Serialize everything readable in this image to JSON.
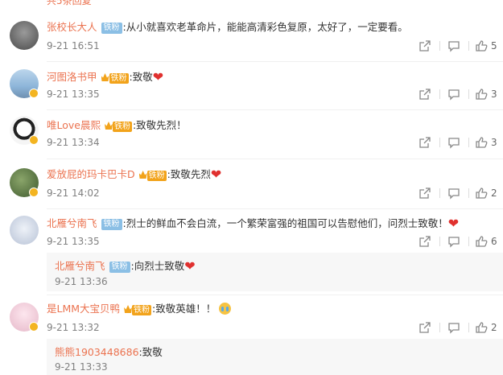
{
  "top_partial": "共5条回复",
  "badges": {
    "fan": "铁粉",
    "gold": "铁粉"
  },
  "comments": [
    {
      "user": "张校长大人",
      "text": ":从小就喜欢老革命片，能能高清彩色复原，太好了，一定要看。",
      "time": "9-21 16:51",
      "likes": "5"
    },
    {
      "user": "河图洛书甲",
      "text": ":致敬",
      "time": "9-21 13:35",
      "likes": "3"
    },
    {
      "user": "唯Love晨熙",
      "text": ":致敬先烈！",
      "time": "9-21 13:34",
      "likes": "3"
    },
    {
      "user": "爱放屁的玛卡巴卡D",
      "text": ":致敬先烈",
      "time": "9-21 14:02",
      "likes": "2"
    },
    {
      "user": "北雁兮南飞",
      "text": ":烈士的鲜血不会白流，一个繁荣富强的祖国可以告慰他们，问烈士致敬！",
      "time": "9-21 13:35",
      "likes": "6",
      "reply": {
        "user": "北雁兮南飞",
        "text": ":向烈士致敬",
        "time": "9-21 13:36"
      }
    },
    {
      "user": "是LMM大宝贝鸭",
      "text": ":致敬英雄！！",
      "time": "9-21 13:32",
      "likes": "2",
      "reply": {
        "user": "熊熊1903448686",
        "text": ":致敬",
        "time": "9-21 13:33"
      }
    }
  ],
  "colors": {
    "username": "#eb7350",
    "fan_badge": "#8bbfe5",
    "gold_badge": "#f2a31b",
    "heart": "#e0312f",
    "time": "#808080"
  }
}
